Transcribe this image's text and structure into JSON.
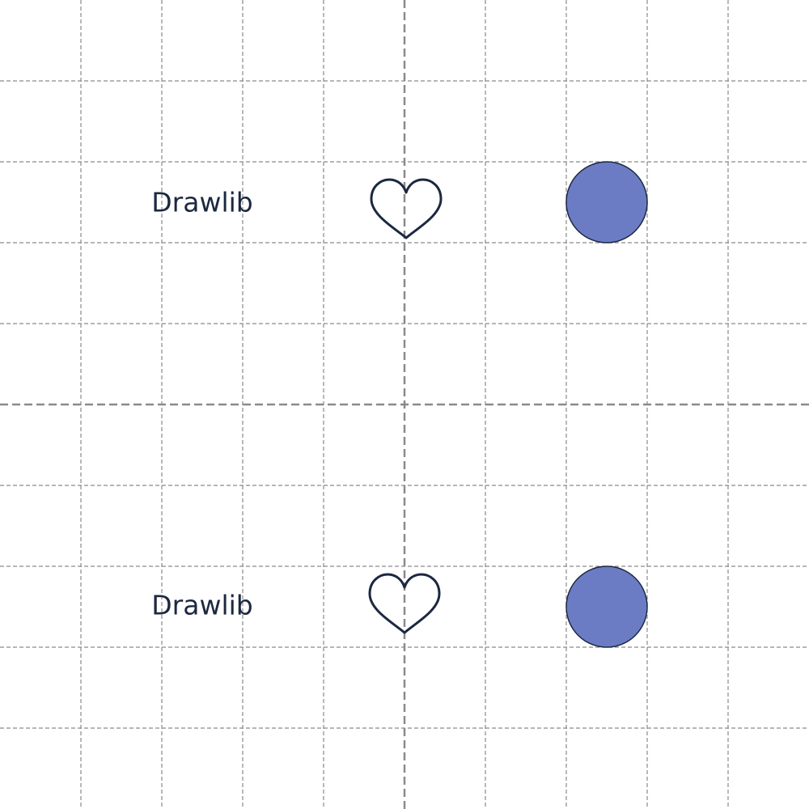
{
  "colors": {
    "background": "#ffffff",
    "grid": "#8a8a8a",
    "ink": "#1c2840",
    "circle_fill": "#6c7cc4"
  },
  "rows": [
    {
      "label": "Drawlib",
      "icon": "heart-outline-icon",
      "shape": "filled-circle"
    },
    {
      "label": "Drawlib",
      "icon": "heart-outline-icon",
      "shape": "filled-circle"
    }
  ]
}
